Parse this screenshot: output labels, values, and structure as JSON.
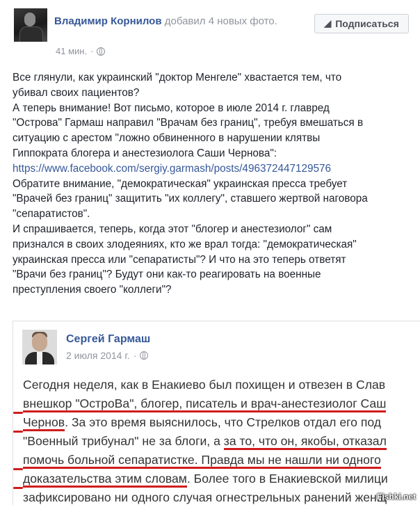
{
  "post": {
    "author": "Владимир Корнилов",
    "action": "добавил 4 новых фото.",
    "time": "41 мин.",
    "subscribe_label": "Подписаться",
    "text_lines": [
      "Все глянули, как украинский \"доктор Менгеле\" хвастается тем, что",
      "убивал своих пациентов?",
      "А теперь внимание! Вот письмо, которое в июле 2014 г. главред",
      "\"Острова\" Гармаш направил \"Врачам без границ\", требуя вмешаться в",
      "ситуацию с арестом \"ложно обвиненного в нарушении клятвы",
      "Гиппократа блогера и анестезиолога Саши Чернова\":"
    ],
    "link": "https://www.facebook.com/sergiy.garmash/posts/496372447129576",
    "text_lines_2": [
      "Обратите внимание, \"демократическая\" украинская пресса требует",
      "\"Врачей без границ\" защитить \"их коллегу\", ставшего жертвой наговора",
      "\"сепаратистов\".",
      "И спрашивается, теперь, когда этот \"блогер и анестезиолог\" сам",
      "признался в своих злодеяниях, кто же врал тогда: \"демократическая\"",
      "украинская пресса или \"сепаратисты\"? И что на это теперь ответят",
      "\"Врачи без границ\"? Будут они как-то реагировать на военные",
      "преступления своего \"коллеги\"?"
    ]
  },
  "shared": {
    "author": "Сергей Гармаш",
    "date": "2 июля 2014 г.",
    "lines": [
      {
        "a": "Сегодня неделя, как в Енакиево был похищен и отвезен в Слав",
        "u": "",
        "b": ""
      },
      {
        "a": "",
        "u": "внешкор \"ОстроВа\", блогер, писатель и врач-анестезиолог Саш",
        "b": ""
      },
      {
        "a": "",
        "u": "Чернов",
        "b": ". За это время выяснилось, что Стрелков отдал его под"
      },
      {
        "a": "\"Военный трибунал\" не за блоги, а ",
        "u": "за то, что он, якобы, отказал",
        "b": ""
      },
      {
        "a": "",
        "u": "помочь больной сепаратистке. Правда мы не нашли ни одного",
        "b": ""
      },
      {
        "a": "",
        "u": "доказательства этим словам",
        "b": ". Более того в Енакиевской милици"
      },
      {
        "a": "зафиксировано ни одного случая огнестрельных ранений женщ",
        "u": "",
        "b": ""
      }
    ]
  },
  "watermark": "Fishki.net",
  "colors": {
    "link": "#365899",
    "underline": "#d01c1c",
    "meta": "#90949c"
  }
}
